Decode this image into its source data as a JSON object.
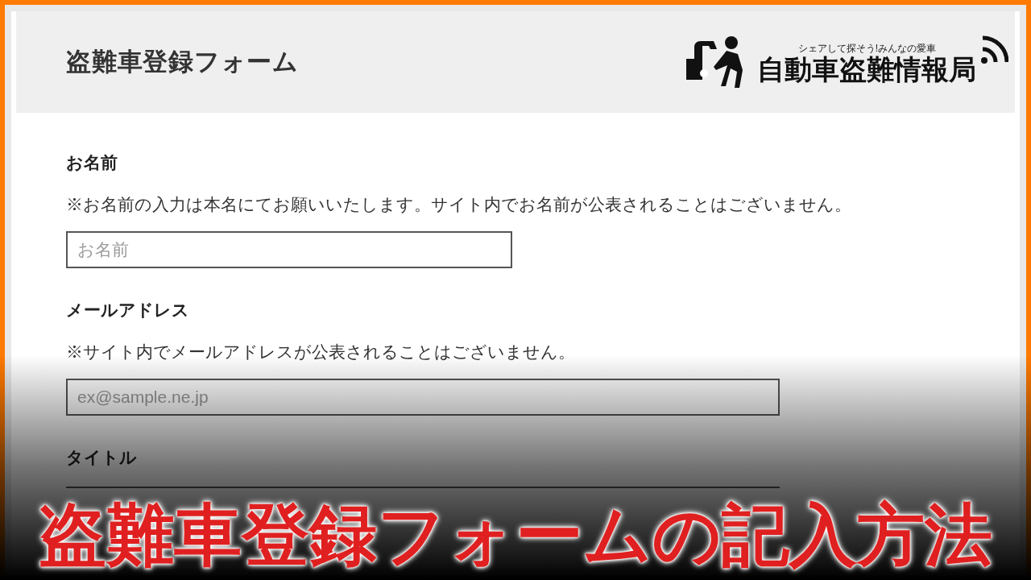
{
  "header": {
    "title": "盗難車登録フォーム",
    "logo": {
      "tagline": "シェアして探そう!みんなの愛車",
      "name": "自動車盗難情報局"
    }
  },
  "fields": [
    {
      "label": "お名前",
      "note": "※お名前の入力は本名にてお願いいたします。サイト内でお名前が公表されることはございません。",
      "placeholder": "お名前",
      "kind": "name"
    },
    {
      "label": "メールアドレス",
      "note": "※サイト内でメールアドレスが公表されることはございません。",
      "placeholder": "ex@sample.ne.jp",
      "kind": "email"
    },
    {
      "label": "タイトル",
      "kind": "text"
    }
  ],
  "banner": {
    "text": "盗難車登録フォームの記入方法"
  }
}
